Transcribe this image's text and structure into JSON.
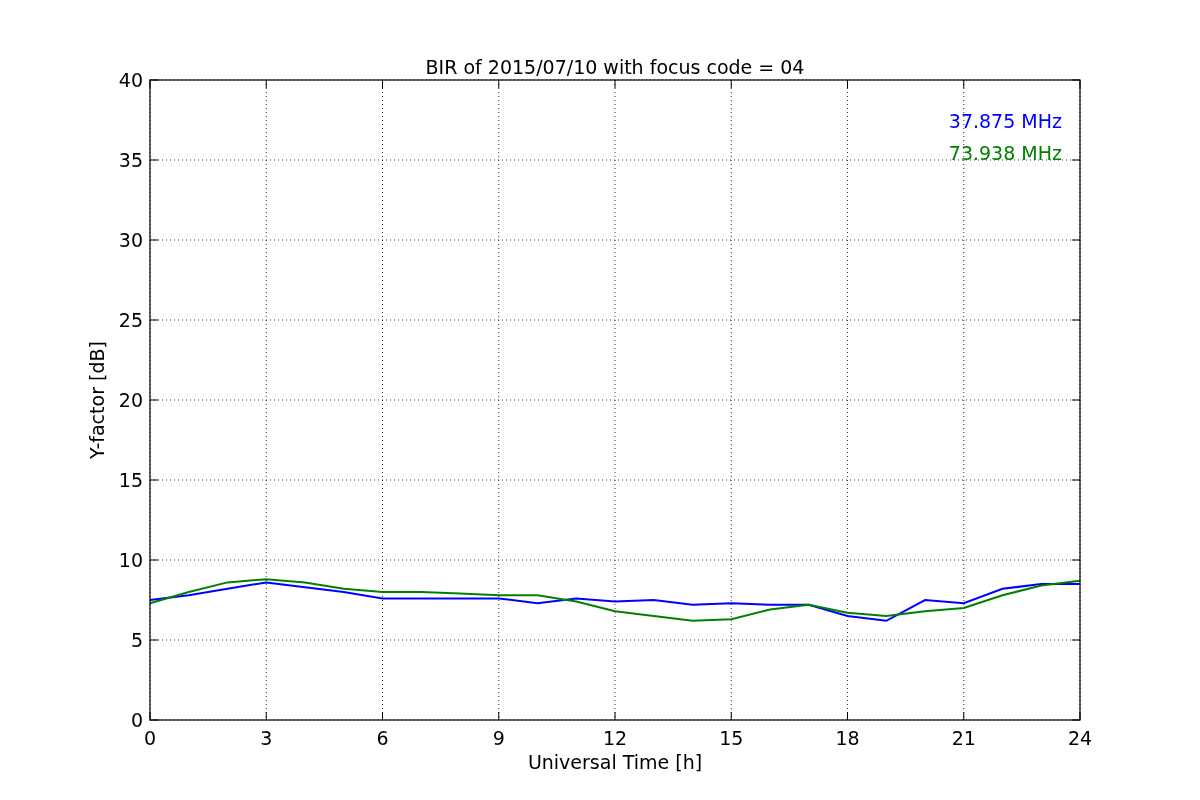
{
  "chart_data": {
    "type": "line",
    "title": "BIR of 2015/07/10 with focus code = 04",
    "xlabel": "Universal Time [h]",
    "ylabel": "Y-factor [dB]",
    "x": [
      0,
      1,
      2,
      3,
      4,
      5,
      6,
      7,
      8,
      9,
      10,
      11,
      12,
      13,
      14,
      15,
      16,
      17,
      18,
      19,
      20,
      21,
      22,
      23,
      24
    ],
    "series": [
      {
        "name": "37.875 MHz",
        "color": "#0000ff",
        "values": [
          7.5,
          7.8,
          8.2,
          8.6,
          8.3,
          8.0,
          7.6,
          7.6,
          7.6,
          7.6,
          7.3,
          7.6,
          7.4,
          7.5,
          7.2,
          7.3,
          7.2,
          7.2,
          6.5,
          6.2,
          7.5,
          7.3,
          8.2,
          8.5,
          8.5
        ]
      },
      {
        "name": "73.938 MHz",
        "color": "#008000",
        "values": [
          7.3,
          8.0,
          8.6,
          8.8,
          8.6,
          8.2,
          8.0,
          8.0,
          7.9,
          7.8,
          7.8,
          7.4,
          6.8,
          6.5,
          6.2,
          6.3,
          6.9,
          7.2,
          6.7,
          6.5,
          6.8,
          7.0,
          7.8,
          8.4,
          8.7
        ]
      }
    ],
    "xlim": [
      0,
      24
    ],
    "ylim": [
      0,
      40
    ],
    "xticks": [
      0,
      3,
      6,
      9,
      12,
      15,
      18,
      21,
      24
    ],
    "yticks": [
      0,
      5,
      10,
      15,
      20,
      25,
      30,
      35,
      40
    ],
    "grid": true
  }
}
